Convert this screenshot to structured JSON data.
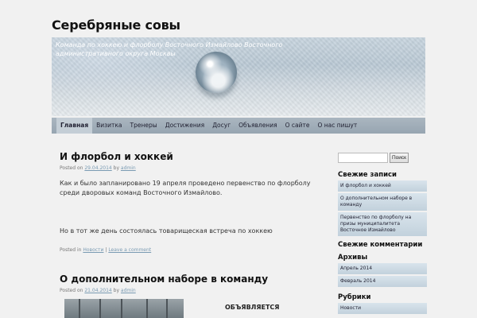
{
  "site": {
    "title": "Серебряные совы",
    "description": "Команда по хоккею и флорболу Восточного Измайлово Восточного административного округа Москвы"
  },
  "nav": {
    "items": [
      "Главная",
      "Визитка",
      "Тренеры",
      "Достижения",
      "Досуг",
      "Объявления",
      "О сайте",
      "О нас пишут"
    ]
  },
  "posts": [
    {
      "title": "И флорбол и хоккей",
      "posted_on_label": "Posted on",
      "date": "29.04.2014",
      "by_label": "by",
      "author": "admin",
      "paragraphs": [
        "Как и было запланировано 19 апреля проведено первенство по флорболу среди дворовых команд Восточного Измайлово.",
        "Но в тот же день состоялась товарищеская встреча по хоккею"
      ],
      "posted_in_label": "Posted in",
      "category": "Новости",
      "comment_link": "Leave a comment"
    },
    {
      "title": "О дополнительном наборе в команду",
      "posted_on_label": "Posted on",
      "date": "21.04.2014",
      "by_label": "by",
      "author": "admin",
      "announcement": "ОБЪЯВЛЯЕТСЯ"
    }
  ],
  "sidebar": {
    "search_button": "Поиск",
    "recent_posts_title": "Свежие записи",
    "recent_posts": [
      "И флорбол и хоккей",
      "О дополнительном наборе в команду",
      "Первенство по флорболу на призы муниципалитета Восточное Измайлово"
    ],
    "recent_comments_title": "Свежие комментарии",
    "archives_title": "Архивы",
    "archives": [
      "Апрель 2014",
      "Февраль 2014"
    ],
    "categories_title": "Рубрики",
    "categories": [
      "Новости"
    ]
  }
}
